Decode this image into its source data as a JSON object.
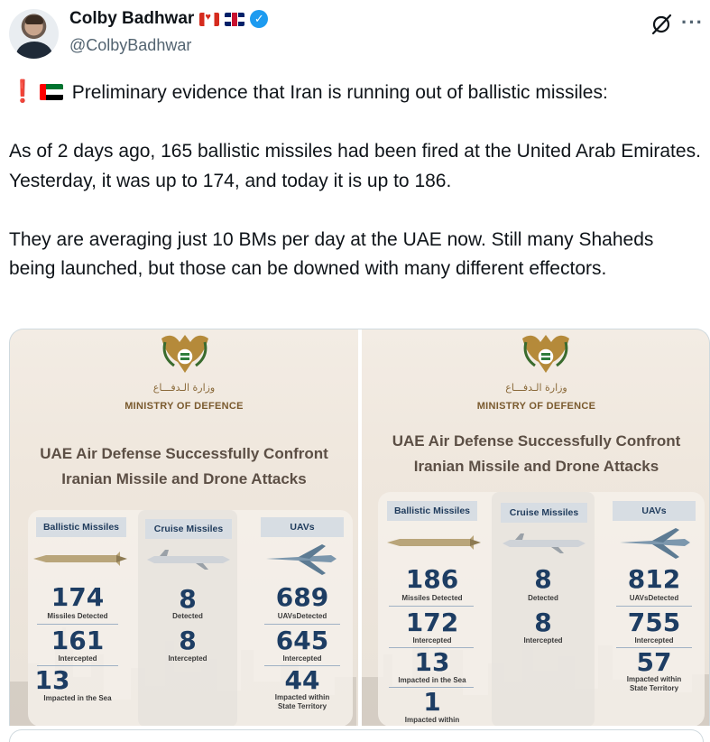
{
  "author": {
    "display_name": "Colby Badhwar",
    "handle": "@ColbyBadhwar",
    "flag_icons": [
      "canada-flag-icon",
      "uk-flag-icon"
    ],
    "verified_icon": "verified-badge-icon"
  },
  "tweet": {
    "line1": "Preliminary evidence that Iran is running out of ballistic missiles:",
    "line1_prefix_icons": [
      "exclamation-icon",
      "uae-flag-icon"
    ],
    "paragraph2": "As of 2 days ago, 165 ballistic missiles had been fired at the United Arab Emirates. Yesterday, it was up to 174, and today it is up to 186.",
    "paragraph3": "They are averaging just 10 BMs per day at the UAE now. Still many Shaheds being launched, but those can be downed with many different effectors."
  },
  "images": [
    {
      "ministry_ar": "وزارة الـدفـــاع",
      "ministry_en": "MINISTRY OF DEFENCE",
      "headline_1": "UAE Air Defense Successfully Confront",
      "headline_2": "Iranian Missile and Drone Attacks",
      "columns": [
        {
          "title": "Ballistic Missiles",
          "stats": [
            {
              "value": "174",
              "label": "Missiles Detected"
            },
            {
              "value": "161",
              "label": "Intercepted"
            },
            {
              "value": "13",
              "label": "Impacted in the Sea"
            }
          ]
        },
        {
          "title": "Cruise Missiles",
          "stats": [
            {
              "value": "8",
              "label": "Detected"
            },
            {
              "value": "8",
              "label": "Intercepted"
            }
          ]
        },
        {
          "title": "UAVs",
          "stats": [
            {
              "value": "689",
              "label": "UAVsDetected"
            },
            {
              "value": "645",
              "label": "Intercepted"
            },
            {
              "value": "44",
              "label": "Impacted within",
              "label2": "State Territory"
            }
          ]
        }
      ]
    },
    {
      "ministry_ar": "وزارة الـدفـــاع",
      "ministry_en": "MINISTRY OF DEFENCE",
      "headline_1": "UAE Air Defense Successfully Confront",
      "headline_2": "Iranian Missile and Drone Attacks",
      "columns": [
        {
          "title": "Ballistic Missiles",
          "stats": [
            {
              "value": "186",
              "label": "Missiles Detected"
            },
            {
              "value": "172",
              "label": "Intercepted"
            },
            {
              "value": "13",
              "label": "Impacted in the Sea"
            },
            {
              "value": "1",
              "label": "Impacted within"
            }
          ]
        },
        {
          "title": "Cruise Missiles",
          "stats": [
            {
              "value": "8",
              "label": "Detected"
            },
            {
              "value": "8",
              "label": "Intercepted"
            }
          ]
        },
        {
          "title": "UAVs",
          "stats": [
            {
              "value": "812",
              "label": "UAVsDetected"
            },
            {
              "value": "755",
              "label": "Intercepted"
            },
            {
              "value": "57",
              "label": "Impacted within",
              "label2": "State Territory"
            }
          ]
        }
      ]
    }
  ],
  "colors": {
    "number_blue": "#1d3d63",
    "header_gray_blue": "#d7dde3",
    "verified_blue": "#1d9bf0",
    "handle_gray": "#536471"
  }
}
